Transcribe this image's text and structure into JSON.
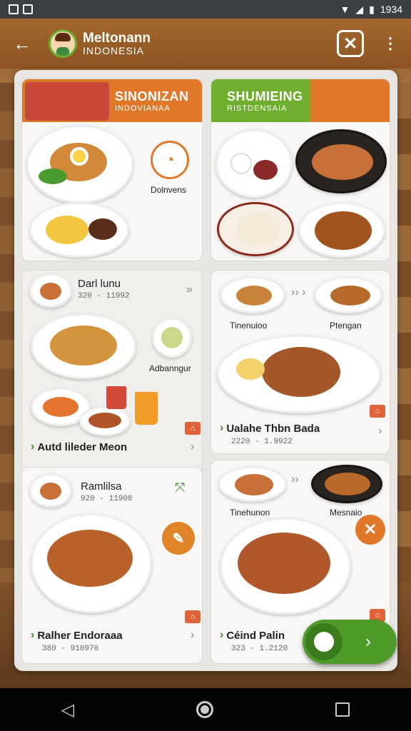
{
  "status": {
    "time": "1934"
  },
  "appbar": {
    "title": "Meltonann",
    "subtitle": "INDONESIA"
  },
  "cards": {
    "c1": {
      "title": "SINONIZAN",
      "subtitle": "INDOVIANAA",
      "label": "Dolnvens",
      "color": "#e0782a"
    },
    "c2": {
      "title": "SHUMIEING",
      "subtitle": "RISTDENSAIA",
      "color": "#6fae2e"
    },
    "c3": {
      "name": "Darl lunu",
      "price": "320 - 11992",
      "label": "Adbanngur",
      "footer": "Autd lileder Meon"
    },
    "c4": {
      "label_left": "Tinenuioo",
      "label_right": "Ptengan",
      "footer": "Ualahe Thbn Bada",
      "price": "2220 - 1.9922"
    },
    "c5": {
      "name": "Ramlilsa",
      "price": "920 - 11908",
      "footer": "Ralher Endoraaa",
      "footer_price": "380 - 910970"
    },
    "c6": {
      "label_left": "Tinehunon",
      "label_right": "Mesnaio",
      "footer": "Céind Palin",
      "price": "323 - 1.2120"
    }
  }
}
